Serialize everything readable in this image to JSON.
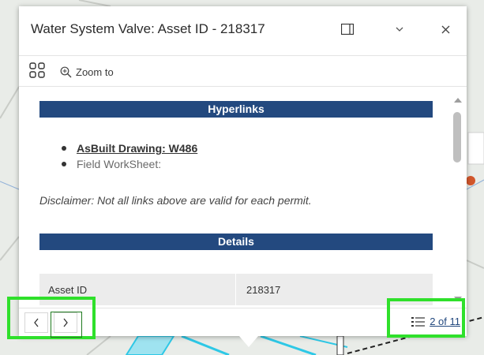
{
  "popup": {
    "title": "Water System Valve: Asset ID - 218317",
    "toolbar": {
      "zoom_to_label": "Zoom to"
    },
    "hyperlinks_section": {
      "heading": "Hyperlinks",
      "links": [
        {
          "label": "AsBuilt Drawing: W486"
        },
        {
          "label": "Field WorkSheet:"
        }
      ],
      "disclaimer": "Disclaimer: Not all links above are valid for each permit."
    },
    "details_section": {
      "heading": "Details",
      "rows": [
        {
          "label": "Asset ID",
          "value": "218317"
        }
      ]
    },
    "footer": {
      "pager_label": "2 of 11"
    }
  },
  "icons": {
    "dock": "dock-panel-icon",
    "collapse": "chevron-down-icon",
    "close": "close-icon",
    "menu": "feature-menu-icon",
    "zoom": "zoom-in-icon",
    "prev": "chevron-left-icon",
    "next": "chevron-right-icon",
    "list": "feature-list-icon"
  },
  "colors": {
    "section_header": "#23497f",
    "highlight": "#2fe02b"
  }
}
